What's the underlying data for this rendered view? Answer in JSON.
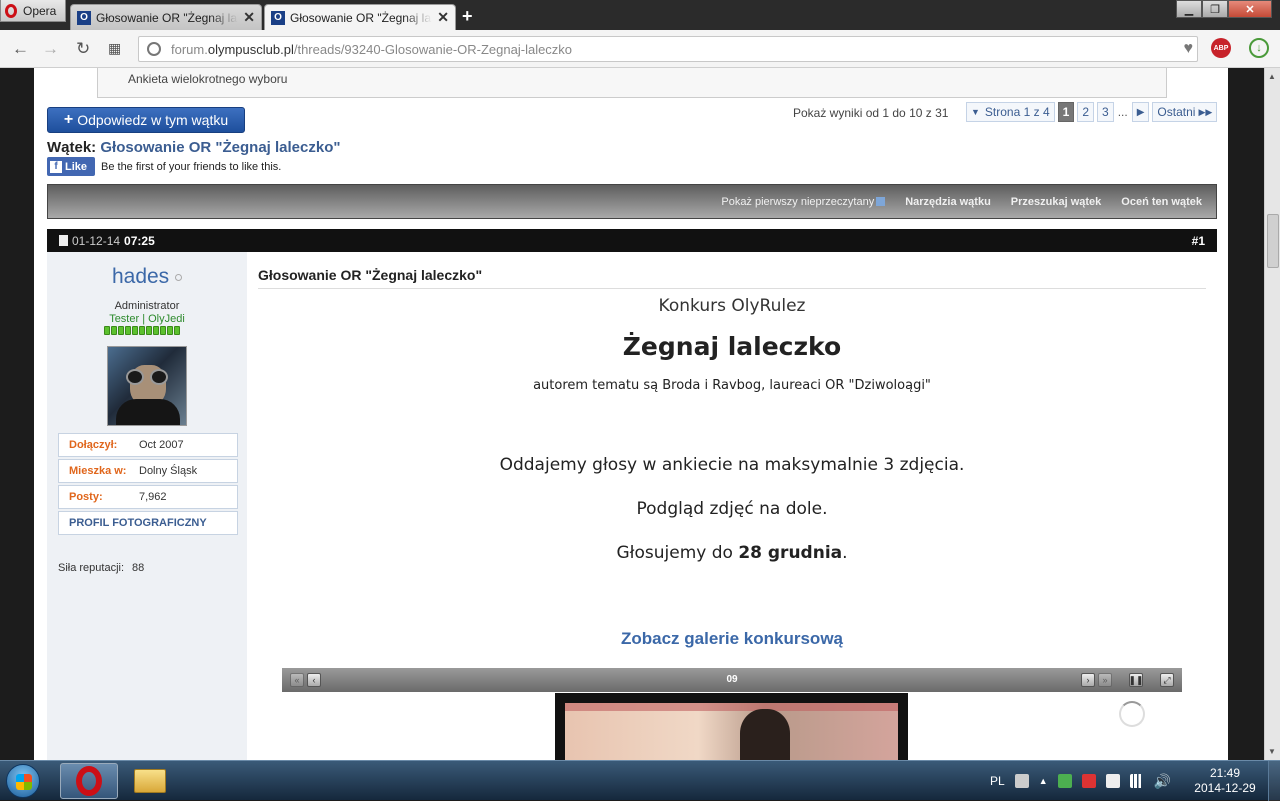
{
  "browser": {
    "menu_label": "Opera",
    "tabs": [
      {
        "title": "Głosowanie OR \"Żegnaj laleczko\"",
        "state": "inactive"
      },
      {
        "title": "Głosowanie OR \"Żegnaj laleczko\"",
        "state": "active"
      }
    ],
    "new_tab_label": "+",
    "address": {
      "host_prefix": "forum.",
      "host": "olympusclub.pl",
      "path": "/threads/93240-Glosowanie-OR-Zegnaj-laleczko"
    },
    "abp_label": "ABP"
  },
  "page": {
    "poll_type": "Ankieta wielokrotnego wyboru",
    "reply_button": "Odpowiedz w tym wątku",
    "results_text": "Pokaż wyniki od 1 do 10 z 31",
    "pager": {
      "page_of": "Strona 1 z 4",
      "pages": [
        "1",
        "2",
        "3"
      ],
      "current": "1",
      "ellipsis": "...",
      "last": "Ostatni"
    },
    "thread": {
      "label": "Wątek:",
      "title": "Głosowanie OR \"Żegnaj laleczko\""
    },
    "facebook": {
      "like_label": "Like",
      "text": "Be the first of your friends to like this."
    },
    "tools": {
      "first_unread": "Pokaż pierwszy nieprzeczytany",
      "thread_tools": "Narzędzia wątku",
      "search_thread": "Przeszukaj wątek",
      "rate_thread": "Oceń ten wątek"
    },
    "post": {
      "date": "01-12-14",
      "time": "07:25",
      "number": "#1",
      "title": "Głosowanie OR \"Żegnaj laleczko\"",
      "user": {
        "name": "hades",
        "rank": "Administrator",
        "groups": "Tester | OlyJedi",
        "reputation_pips": 11,
        "joined_label": "Dołączył:",
        "joined": "Oct 2007",
        "location_label": "Mieszka w:",
        "location": "Dolny Śląsk",
        "posts_label": "Posty:",
        "posts": "7,962",
        "profile_link": "PROFIL FOTOGRAFICZNY",
        "reputation_label": "Siła reputacji:",
        "reputation": "88"
      },
      "content": {
        "contest": "Konkurs OlyRulez",
        "theme": "Żegnaj laleczko",
        "authors": "autorem tematu są Broda i Ravbog, laureaci OR \"Dziwoloągi\"",
        "vote_info": "Oddajemy głosy w ankiecie na maksymalnie 3 zdjęcia.",
        "preview_info": "Podgląd zdjęć na dole.",
        "deadline_prefix": "Głosujemy do ",
        "deadline": "28 grudnia",
        "deadline_suffix": ".",
        "gallery_link": "Zobacz galerie konkursową",
        "slide_number": "09"
      }
    }
  },
  "taskbar": {
    "language": "PL",
    "time": "21:49",
    "date": "2014-12-29"
  }
}
